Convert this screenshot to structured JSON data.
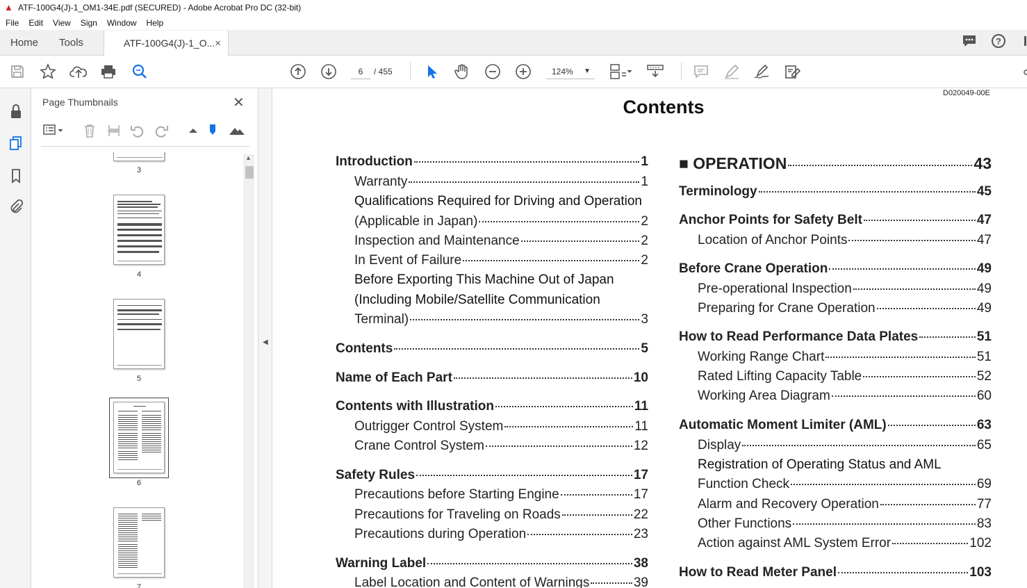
{
  "window": {
    "title": "ATF-100G4(J)-1_OM1-34E.pdf (SECURED) - Adobe Acrobat Pro DC (32-bit)"
  },
  "menu": {
    "items": [
      "File",
      "Edit",
      "View",
      "Sign",
      "Window",
      "Help"
    ]
  },
  "tabs": {
    "home": "Home",
    "tools": "Tools",
    "document": "ATF-100G4(J)-1_O...",
    "close": "×"
  },
  "toolbar": {
    "page_current": "6",
    "page_total": "/ 455",
    "zoom": "124%"
  },
  "panel": {
    "title": "Page Thumbnails",
    "thumbnails": [
      {
        "label": "3"
      },
      {
        "label": "4"
      },
      {
        "label": "5"
      },
      {
        "label": "6",
        "selected": true
      },
      {
        "label": "7"
      }
    ]
  },
  "document": {
    "doc_id": "D020049-00E",
    "title": "Contents",
    "left_column": [
      {
        "text": "Introduction",
        "page": "1",
        "level": 1
      },
      {
        "text": "Warranty",
        "page": "1",
        "level": 2
      },
      {
        "text": "Qualifications Required for Driving and Operation",
        "page": "",
        "level": 2
      },
      {
        "text": "(Applicable in Japan)",
        "page": "2",
        "level": 2
      },
      {
        "text": "Inspection and Maintenance",
        "page": "2",
        "level": 2
      },
      {
        "text": "In Event of Failure",
        "page": "2",
        "level": 2
      },
      {
        "text": "Before Exporting This Machine Out of Japan",
        "page": "",
        "level": 2
      },
      {
        "text": "(Including Mobile/Satellite Communication",
        "page": "",
        "level": 2
      },
      {
        "text": "Terminal)",
        "page": "3",
        "level": 2
      },
      {
        "text": "Contents",
        "page": "5",
        "level": 1
      },
      {
        "text": "Name of Each Part",
        "page": "10",
        "level": 1
      },
      {
        "text": "Contents with Illustration",
        "page": "11",
        "level": 1
      },
      {
        "text": "Outrigger Control System",
        "page": "11",
        "level": 2
      },
      {
        "text": "Crane Control System",
        "page": "12",
        "level": 2
      },
      {
        "text": "Safety Rules",
        "page": "17",
        "level": 1
      },
      {
        "text": "Precautions before Starting Engine",
        "page": "17",
        "level": 2
      },
      {
        "text": "Precautions for Traveling on Roads",
        "page": "22",
        "level": 2
      },
      {
        "text": "Precautions during Operation",
        "page": "23",
        "level": 2
      },
      {
        "text": "Warning Label",
        "page": "38",
        "level": 1
      },
      {
        "text": "Label Location and Content of Warnings",
        "page": "39",
        "level": 2
      }
    ],
    "right_column": [
      {
        "text": "■ OPERATION",
        "page": "43",
        "level": 0
      },
      {
        "text": "Terminology",
        "page": "45",
        "level": 1
      },
      {
        "text": "Anchor Points for Safety Belt",
        "page": "47",
        "level": 1
      },
      {
        "text": "Location of Anchor Points",
        "page": "47",
        "level": 2
      },
      {
        "text": "Before Crane Operation",
        "page": "49",
        "level": 1
      },
      {
        "text": "Pre-operational Inspection",
        "page": "49",
        "level": 2
      },
      {
        "text": "Preparing for Crane Operation",
        "page": "49",
        "level": 2
      },
      {
        "text": "How to Read Performance Data Plates",
        "page": "51",
        "level": 1
      },
      {
        "text": "Working Range Chart",
        "page": "51",
        "level": 2
      },
      {
        "text": "Rated Lifting Capacity Table",
        "page": "52",
        "level": 2
      },
      {
        "text": "Working Area Diagram",
        "page": "60",
        "level": 2
      },
      {
        "text": "Automatic Moment Limiter (AML)",
        "page": "63",
        "level": 1
      },
      {
        "text": "Display",
        "page": "65",
        "level": 2
      },
      {
        "text": "Registration of Operating Status and AML",
        "page": "",
        "level": 2
      },
      {
        "text": "Function Check",
        "page": "69",
        "level": 2
      },
      {
        "text": "Alarm and Recovery Operation",
        "page": "77",
        "level": 2
      },
      {
        "text": "Other Functions",
        "page": "83",
        "level": 2
      },
      {
        "text": "Action against AML System Error",
        "page": "102",
        "level": 2
      },
      {
        "text": "How to Read Meter Panel",
        "page": "103",
        "level": 1
      }
    ]
  }
}
